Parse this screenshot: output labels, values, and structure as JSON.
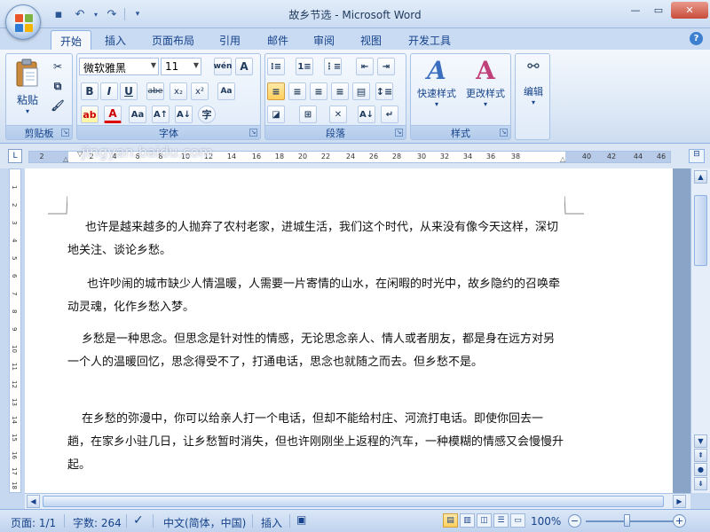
{
  "window": {
    "title": "故乡节选 - Microsoft Word",
    "minimize_icon": "minimize-icon",
    "maximize_icon": "maximize-icon",
    "close_icon": "close-icon"
  },
  "qat": {
    "save_icon": "save-icon",
    "undo_icon": "undo-icon",
    "redo_icon": "redo-icon",
    "customize_icon": "chevron-down-icon"
  },
  "tabs": [
    {
      "label": "开始",
      "active": true
    },
    {
      "label": "插入"
    },
    {
      "label": "页面布局"
    },
    {
      "label": "引用"
    },
    {
      "label": "邮件"
    },
    {
      "label": "审阅"
    },
    {
      "label": "视图"
    },
    {
      "label": "开发工具"
    }
  ],
  "ribbon": {
    "clipboard": {
      "label": "剪贴板",
      "paste": "粘贴"
    },
    "font": {
      "label": "字体",
      "name": "微软雅黑",
      "size": "11",
      "bold": "B",
      "italic": "I",
      "underline": "U",
      "strike": "abe",
      "subscript": "x₂",
      "superscript": "x²",
      "phonetic": "wén",
      "border": "A",
      "highlight": "ab",
      "font_color": "A",
      "case": "Aa"
    },
    "paragraph": {
      "label": "段落"
    },
    "styles": {
      "label": "样式",
      "quick": "快速样式",
      "change": "更改样式"
    },
    "editing": {
      "label": "编辑"
    }
  },
  "ruler": {
    "tab_selector": "L",
    "ticks": [
      "2",
      "2",
      "4",
      "6",
      "8",
      "10",
      "12",
      "14",
      "16",
      "18",
      "20",
      "22",
      "24",
      "26",
      "28",
      "30",
      "32",
      "34",
      "36",
      "38",
      "40",
      "42",
      "44",
      "46"
    ]
  },
  "vruler_ticks": [
    "1",
    "2",
    "3",
    "4",
    "5",
    "6",
    "7",
    "8",
    "9",
    "10",
    "11",
    "12",
    "13",
    "14",
    "15",
    "16",
    "17",
    "18"
  ],
  "document": {
    "paragraphs": [
      "也许是越来越多的人抛弃了农村老家，进城生活，我们这个时代，从来没有像今天这样，深切地关注、谈论乡愁。",
      "也许吵闹的城市缺少人情温暖，人需要一片寄情的山水，在闲暇的时光中，故乡隐约的召唤牵动灵魂，化作乡愁入梦。",
      "乡愁是一种思念。但思念是针对性的情感，无论思念亲人、情人或者朋友，都是身在远方对另一个人的温暖回忆，思念得受不了，打通电话，思念也就随之而去。但乡愁不是。",
      "在乡愁的弥漫中，你可以给亲人打一个电话，但却不能给村庄、河流打电话。即使你回去一趟，在家乡小驻几日，让乡愁暂时消失，但也许刚刚坐上返程的汽车，一种模糊的情感又会慢慢升起。"
    ]
  },
  "status": {
    "page": "页面: 1/1",
    "words": "字数: 264",
    "language": "中文(简体，中国)",
    "mode": "插入",
    "zoom": "100%",
    "zoom_level": 1.0
  },
  "watermark": {
    "brand": "Baidu 经验",
    "url": "jingyan.baidu.com"
  },
  "colors": {
    "ribbon_blue": "#15428b",
    "active_highlight": "#ffcf5c"
  }
}
